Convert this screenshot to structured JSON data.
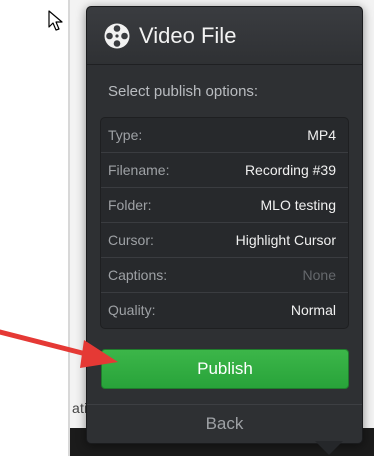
{
  "background": {
    "partial_text": "ati"
  },
  "panel": {
    "title": "Video File",
    "title_icon": "film-reel-icon",
    "subtitle": "Select publish options:",
    "options": [
      {
        "label": "Type:",
        "value": "MP4",
        "muted": false
      },
      {
        "label": "Filename:",
        "value": "Recording #39",
        "muted": false
      },
      {
        "label": "Folder:",
        "value": "MLO testing",
        "muted": false
      },
      {
        "label": "Cursor:",
        "value": "Highlight Cursor",
        "muted": false
      },
      {
        "label": "Captions:",
        "value": "None",
        "muted": true
      },
      {
        "label": "Quality:",
        "value": "Normal",
        "muted": false
      }
    ],
    "publish_label": "Publish",
    "back_label": "Back"
  },
  "colors": {
    "panel_bg": "#2e3033",
    "publish_green": "#2eaa3f",
    "arrow_red": "#e53935"
  }
}
